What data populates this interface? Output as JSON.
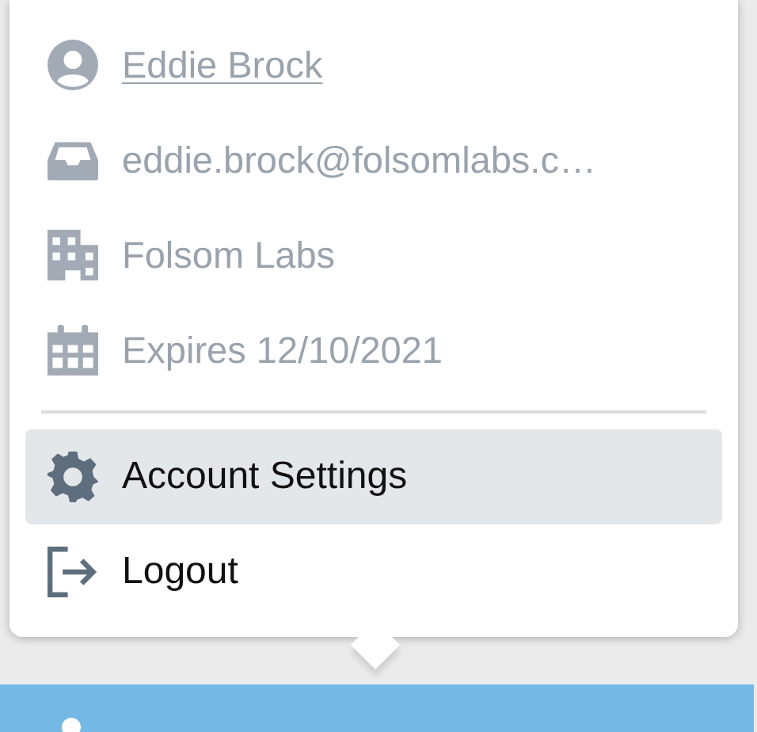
{
  "profile": [
    {
      "kind": "link",
      "text": "Eddie Brock"
    },
    {
      "kind": "info",
      "text": "eddie.brock@folsomlabs.c…"
    },
    {
      "kind": "info",
      "text": "Folsom Labs"
    },
    {
      "kind": "info",
      "text": "Expires 12/10/2021"
    }
  ],
  "menu": [
    {
      "label": "Account Settings",
      "selected": true
    },
    {
      "label": "Logout",
      "selected": false
    }
  ]
}
